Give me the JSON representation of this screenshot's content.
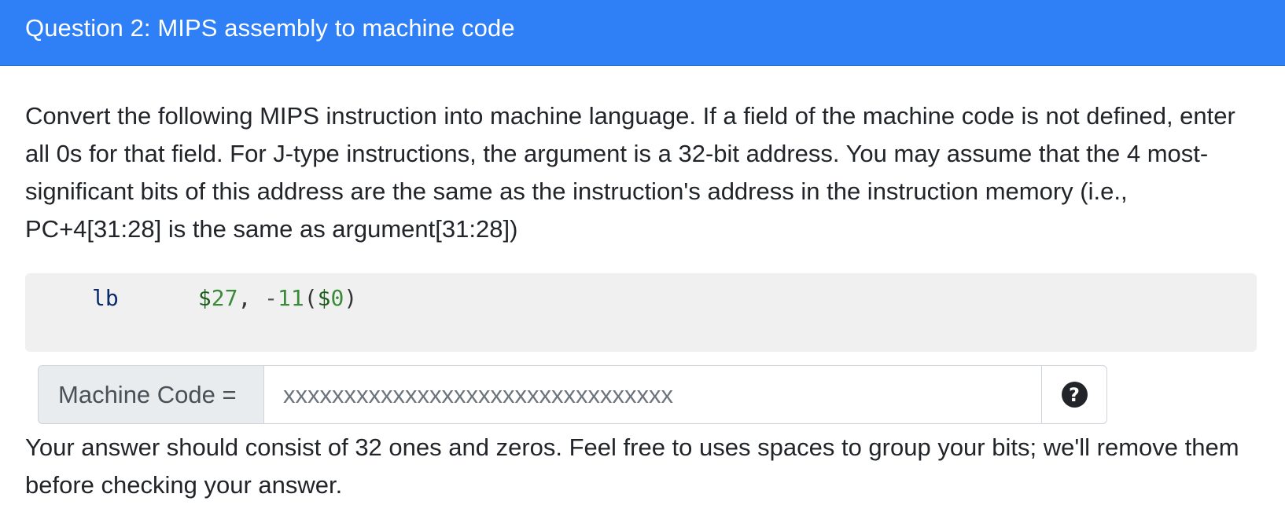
{
  "header": {
    "title": "Question 2: MIPS assembly to machine code",
    "bg_color": "#2f80f6"
  },
  "prompt": {
    "text": "Convert the following MIPS instruction into machine language. If a field of the machine code is not defined, enter all 0s for that field. For J-type instructions, the argument is a 32-bit address. You may assume that the 4 most-significant bits of this address are the same as the instruction's address in the instruction memory (i.e., PC+4[31:28] is the same as argument[31:28])"
  },
  "code": {
    "opcode": "lb",
    "rt_dollar": "$",
    "rt_num": "27",
    "comma": ",",
    "minus": "-",
    "offset": "11",
    "open_paren": "(",
    "rs_dollar": "$",
    "rs_num": "0",
    "close_paren": ")"
  },
  "answer": {
    "label": "Machine Code =",
    "placeholder": "xxxxxxxxxxxxxxxxxxxxxxxxxxxxxxxx",
    "value": "",
    "help_icon": "question-circle-icon"
  },
  "hint": {
    "text": "Your answer should consist of 32 ones and zeros. Feel free to uses spaces to group your bits; we'll remove them before checking your answer."
  }
}
